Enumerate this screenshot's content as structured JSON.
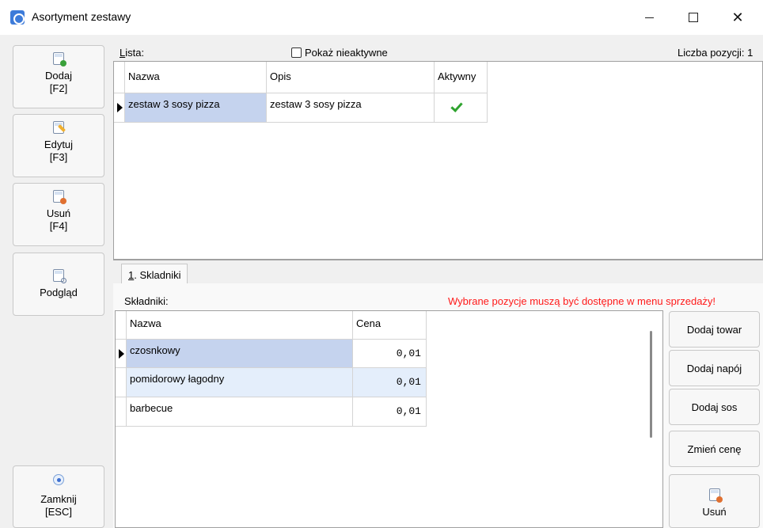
{
  "window": {
    "title": "Asortyment zestawy",
    "minimize": "—",
    "maximize": "□",
    "close": "✕"
  },
  "left_buttons": [
    {
      "label": "Dodaj\n[F2]",
      "icon": "add-document-icon"
    },
    {
      "label": "Edytuj\n[F3]",
      "icon": "edit-document-icon"
    },
    {
      "label": "Usuń\n[F4]",
      "icon": "delete-document-icon"
    },
    {
      "label": "Podgląd",
      "icon": "preview-document-icon"
    },
    {
      "label": "Zamknij\n[ESC]",
      "icon": "close-radio-icon"
    }
  ],
  "lista": {
    "label_prefix": "L",
    "label_rest": "ista:",
    "show_inactive_label": "Pokaż nieaktywne",
    "show_inactive_checked": false,
    "count_label": "Liczba pozycji: 1",
    "columns": [
      "Nazwa",
      "Opis",
      "Aktywny"
    ],
    "rows": [
      {
        "nazwa": "zestaw 3 sosy pizza",
        "opis": "zestaw 3 sosy pizza",
        "aktywny": true
      }
    ]
  },
  "tabs": [
    {
      "prefix": "1",
      "rest": ". Skladniki"
    }
  ],
  "skladniki": {
    "label": "Składniki:",
    "warning": "Wybrane pozycje muszą być dostępne w menu sprzedaży!",
    "columns": [
      "Nazwa",
      "Cena"
    ],
    "rows": [
      {
        "nazwa": "czosnkowy",
        "cena": "0,01"
      },
      {
        "nazwa": "pomidorowy łagodny",
        "cena": "0,01"
      },
      {
        "nazwa": "barbecue",
        "cena": "0,01"
      }
    ]
  },
  "right_buttons": {
    "add_item": "Dodaj towar",
    "add_drink": "Dodaj napój",
    "add_sauce": "Dodaj sos",
    "change_price": "Zmień cenę",
    "remove": "Usuń"
  },
  "colors": {
    "selection": "#c5d3ee",
    "selection_light": "#e4eefb",
    "warning": "#ff1a1a",
    "active_check": "#2fa32f"
  }
}
